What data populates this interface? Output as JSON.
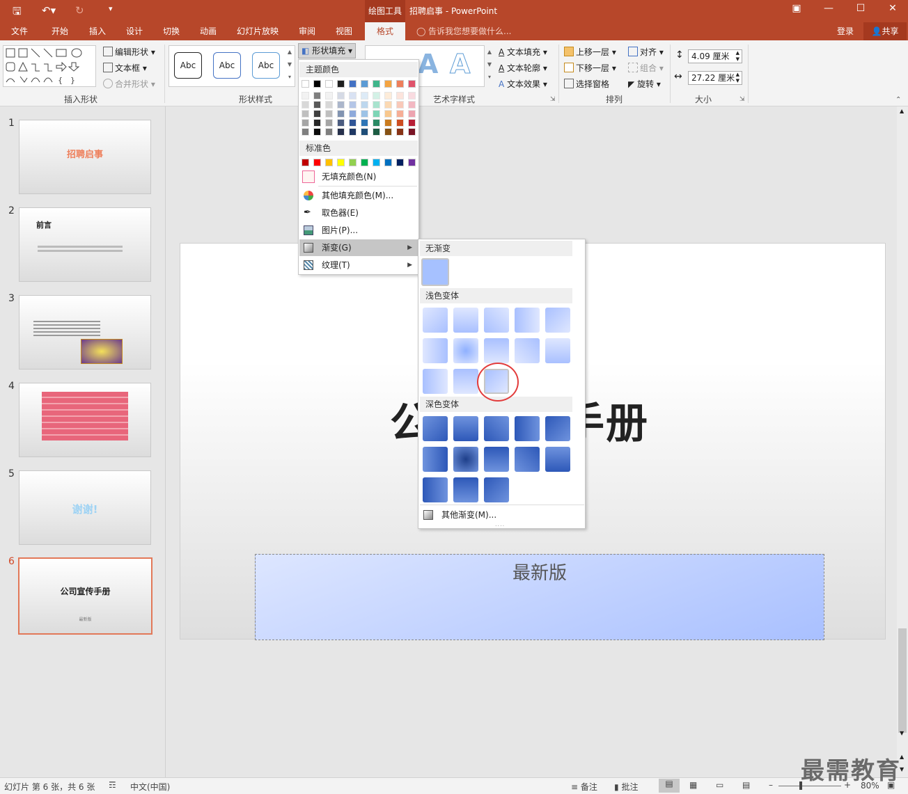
{
  "titlebar": {
    "tools_tab": "绘图工具",
    "doc_title": "招聘启事 - PowerPoint"
  },
  "menu": {
    "file": "文件",
    "home": "开始",
    "insert": "插入",
    "design": "设计",
    "transitions": "切换",
    "animations": "动画",
    "slideshow": "幻灯片放映",
    "review": "审阅",
    "view": "视图",
    "format": "格式",
    "tellme": "告诉我您想要做什么...",
    "login": "登录",
    "share": "共享"
  },
  "ribbon": {
    "edit_shape": "编辑形状",
    "textbox": "文本框",
    "merge_shapes": "合并形状",
    "insert_shapes_label": "插入形状",
    "style_abc": "Abc",
    "shape_styles_label": "形状样式",
    "shape_fill": "形状填充",
    "text_fill": "文本填充",
    "text_outline": "文本轮廓",
    "text_effects": "文本效果",
    "wordart_label": "艺术字样式",
    "bring_forward": "上移一层",
    "send_backward": "下移一层",
    "selection_pane": "选择窗格",
    "align": "对齐",
    "group": "组合",
    "rotate": "旋转",
    "arrange_label": "排列",
    "height": "4.09 厘米",
    "width": "27.22 厘米",
    "size_label": "大小"
  },
  "fillmenu": {
    "theme_colors": "主题颜色",
    "standard_colors": "标准色",
    "no_fill": "无填充颜色(N)",
    "more_colors": "其他填充颜色(M)...",
    "eyedropper": "取色器(E)",
    "picture": "图片(P)...",
    "gradient": "渐变(G)",
    "texture": "纹理(T)",
    "theme_top": [
      "#ffffff",
      "#000000",
      "#ffffff",
      "#1f1f1f",
      "#4472c4",
      "#5b9bd5",
      "#3fb68b",
      "#f4a442",
      "#ee7f5b",
      "#e0546c"
    ],
    "theme_cols": [
      [
        "#f2f2f2",
        "#d8d8d8",
        "#bfbfbf",
        "#a5a5a5",
        "#7f7f7f"
      ],
      [
        "#7f7f7f",
        "#595959",
        "#3f3f3f",
        "#262626",
        "#0c0c0c"
      ],
      [
        "#f2f2f2",
        "#d8d8d8",
        "#bfbfbf",
        "#a5a5a5",
        "#7f7f7f"
      ],
      [
        "#d5dae5",
        "#abb6cb",
        "#8294b1",
        "#4b5c80",
        "#27314c"
      ],
      [
        "#d9e2f3",
        "#b4c6e7",
        "#8eaadb",
        "#2f5597",
        "#1f3864"
      ],
      [
        "#ddebf7",
        "#bdd7ee",
        "#9dc3e6",
        "#2e75b6",
        "#1f4e79"
      ],
      [
        "#d3f1e6",
        "#a8e3ce",
        "#7dd5b6",
        "#2a8a64",
        "#1c5c43"
      ],
      [
        "#fdecd9",
        "#fbd9b3",
        "#f8c78d",
        "#c97b1e",
        "#865214"
      ],
      [
        "#fce4dc",
        "#f9c9b9",
        "#f6ae96",
        "#cd4d21",
        "#883316"
      ],
      [
        "#f9dbe0",
        "#f3b8c2",
        "#eda4b0",
        "#b82037",
        "#7a1525"
      ]
    ],
    "standard": [
      "#c00000",
      "#ff0000",
      "#ffc000",
      "#ffff00",
      "#92d050",
      "#00b050",
      "#00b0f0",
      "#0070c0",
      "#002060",
      "#7030a0"
    ]
  },
  "gradmenu": {
    "no_gradient": "无渐变",
    "light_variations": "浅色变体",
    "dark_variations": "深色变体",
    "more_gradients": "其他渐变(M)..."
  },
  "thumbs": {
    "n1": "1",
    "n2": "2",
    "n3": "3",
    "n4": "4",
    "n5": "5",
    "n6": "6",
    "t1": "招聘启事",
    "t2": "前言",
    "t5": "谢谢!",
    "t6": "公司宣传手册",
    "t6sub": "最新版"
  },
  "slide": {
    "title": "公司宣传手册",
    "subtitle": "最新版"
  },
  "status": {
    "slide_info": "幻灯片 第 6 张，共 6 张",
    "language": "中文(中国)",
    "notes": "备注",
    "comments": "批注",
    "zoom": "80%"
  },
  "watermark": "最需教育"
}
